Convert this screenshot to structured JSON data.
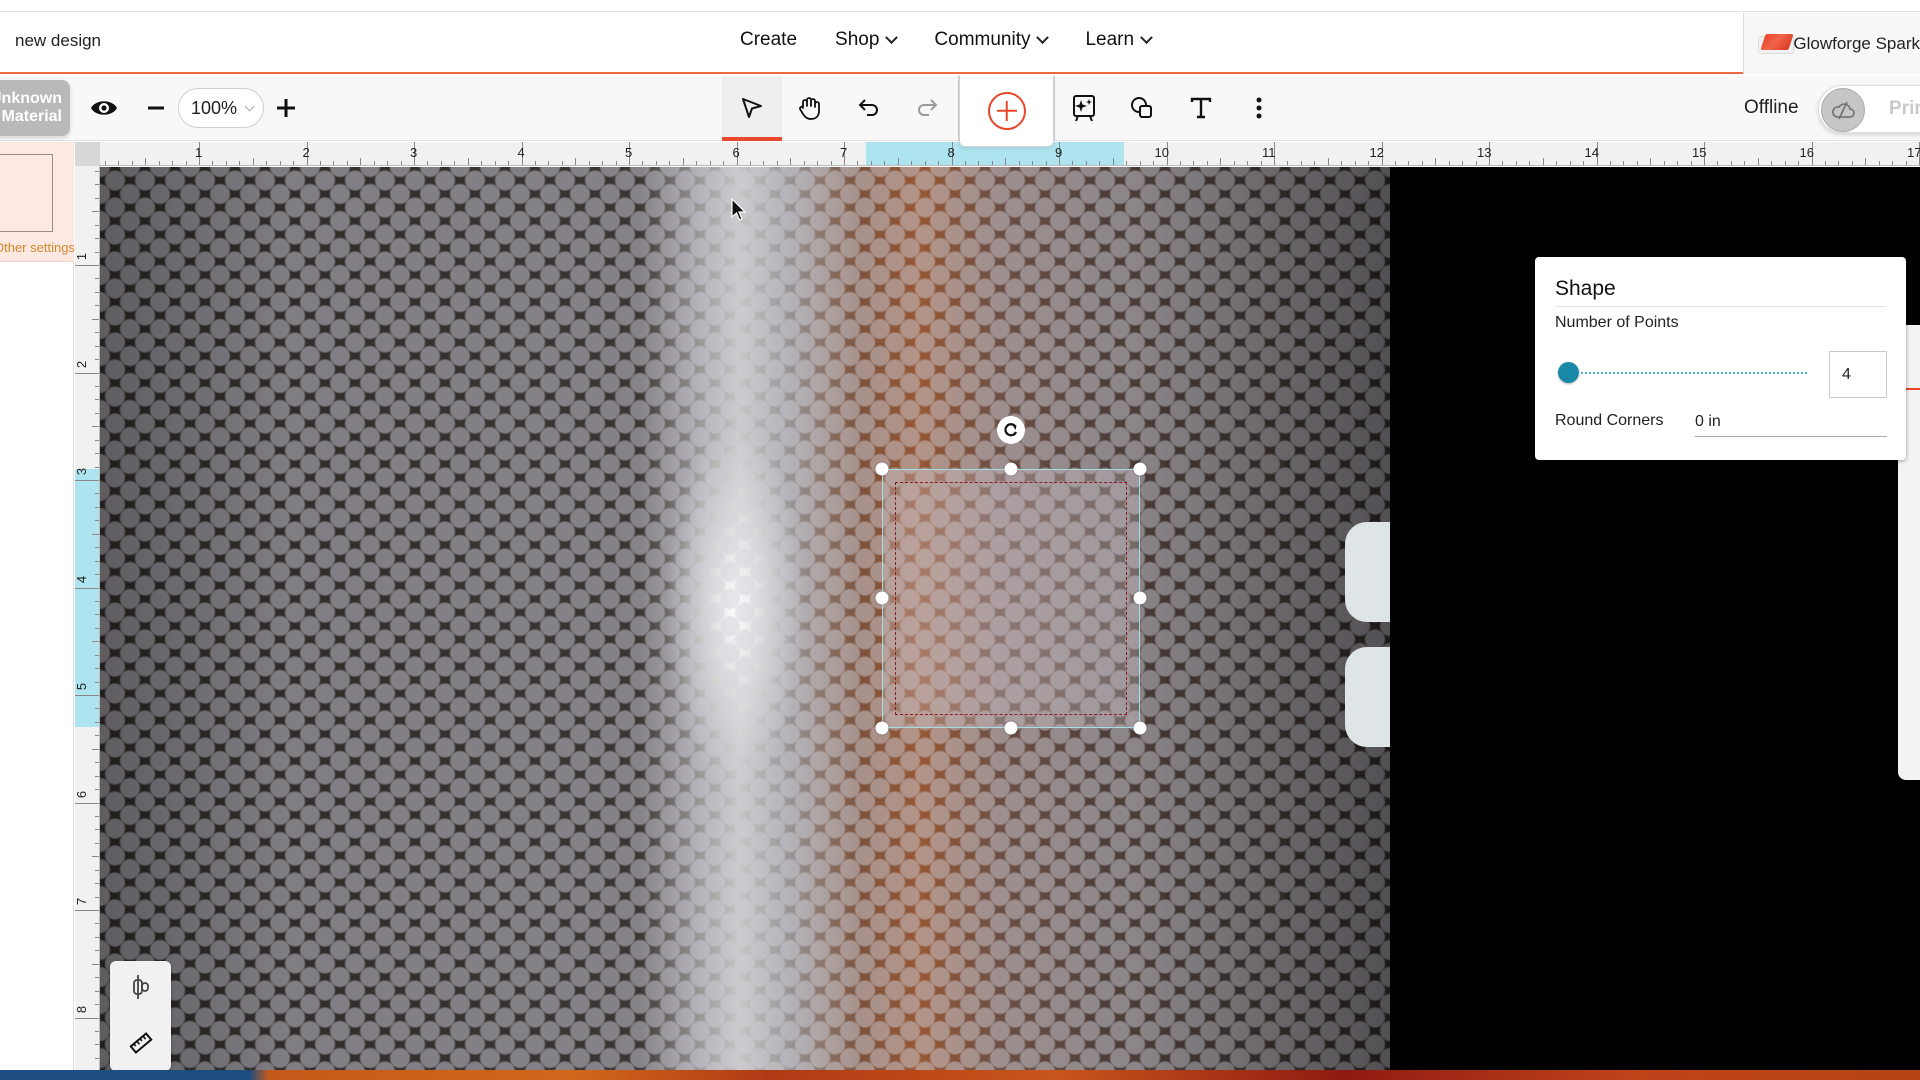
{
  "nav": {
    "design_title": "new design",
    "menu": [
      {
        "label": "Create",
        "has_dropdown": false
      },
      {
        "label": "Shop",
        "has_dropdown": true
      },
      {
        "label": "Community",
        "has_dropdown": true
      },
      {
        "label": "Learn",
        "has_dropdown": true
      }
    ],
    "machine_name": "Glowforge Spark"
  },
  "toolbar": {
    "material_label": "Unknown Material",
    "zoom_level": "100%",
    "status": "Offline",
    "print_label": "Print",
    "icons": [
      "eye-icon",
      "zoom-out-icon",
      "zoom-in-icon",
      "select-pointer-icon",
      "hand-pan-icon",
      "undo-icon",
      "redo-icon",
      "add-icon",
      "magic-canvas-icon",
      "shapes-icon",
      "text-icon",
      "more-vertical-icon",
      "cloud-offline-icon"
    ],
    "active_tool": "select",
    "redo_enabled": false
  },
  "left_panel": {
    "settings_link": "Other settings"
  },
  "rulers": {
    "unit": "in",
    "horizontal": [
      "1",
      "2",
      "3",
      "4",
      "5",
      "6",
      "7",
      "8",
      "9",
      "10",
      "11",
      "12",
      "13",
      "14",
      "15",
      "16",
      "17"
    ],
    "vertical": [
      "1",
      "2",
      "3",
      "4",
      "5",
      "6",
      "7",
      "8"
    ],
    "horizontal_highlight_in": [
      7.2,
      9.6
    ],
    "vertical_highlight_in": [
      2.9,
      5.3
    ]
  },
  "shape_panel": {
    "title": "Shape",
    "points_label": "Number of Points",
    "points_value": "4",
    "points_slider_fraction": 0,
    "round_corners_label": "Round Corners",
    "round_corners_value": "0 in"
  },
  "bottom_tools": {
    "icons": [
      "align-icon",
      "ruler-icon"
    ]
  },
  "colors": {
    "accent": "#e8472a",
    "slider": "#1888a6",
    "ruler_highlight": "#aee4ef",
    "settings_link": "#d4882d"
  }
}
